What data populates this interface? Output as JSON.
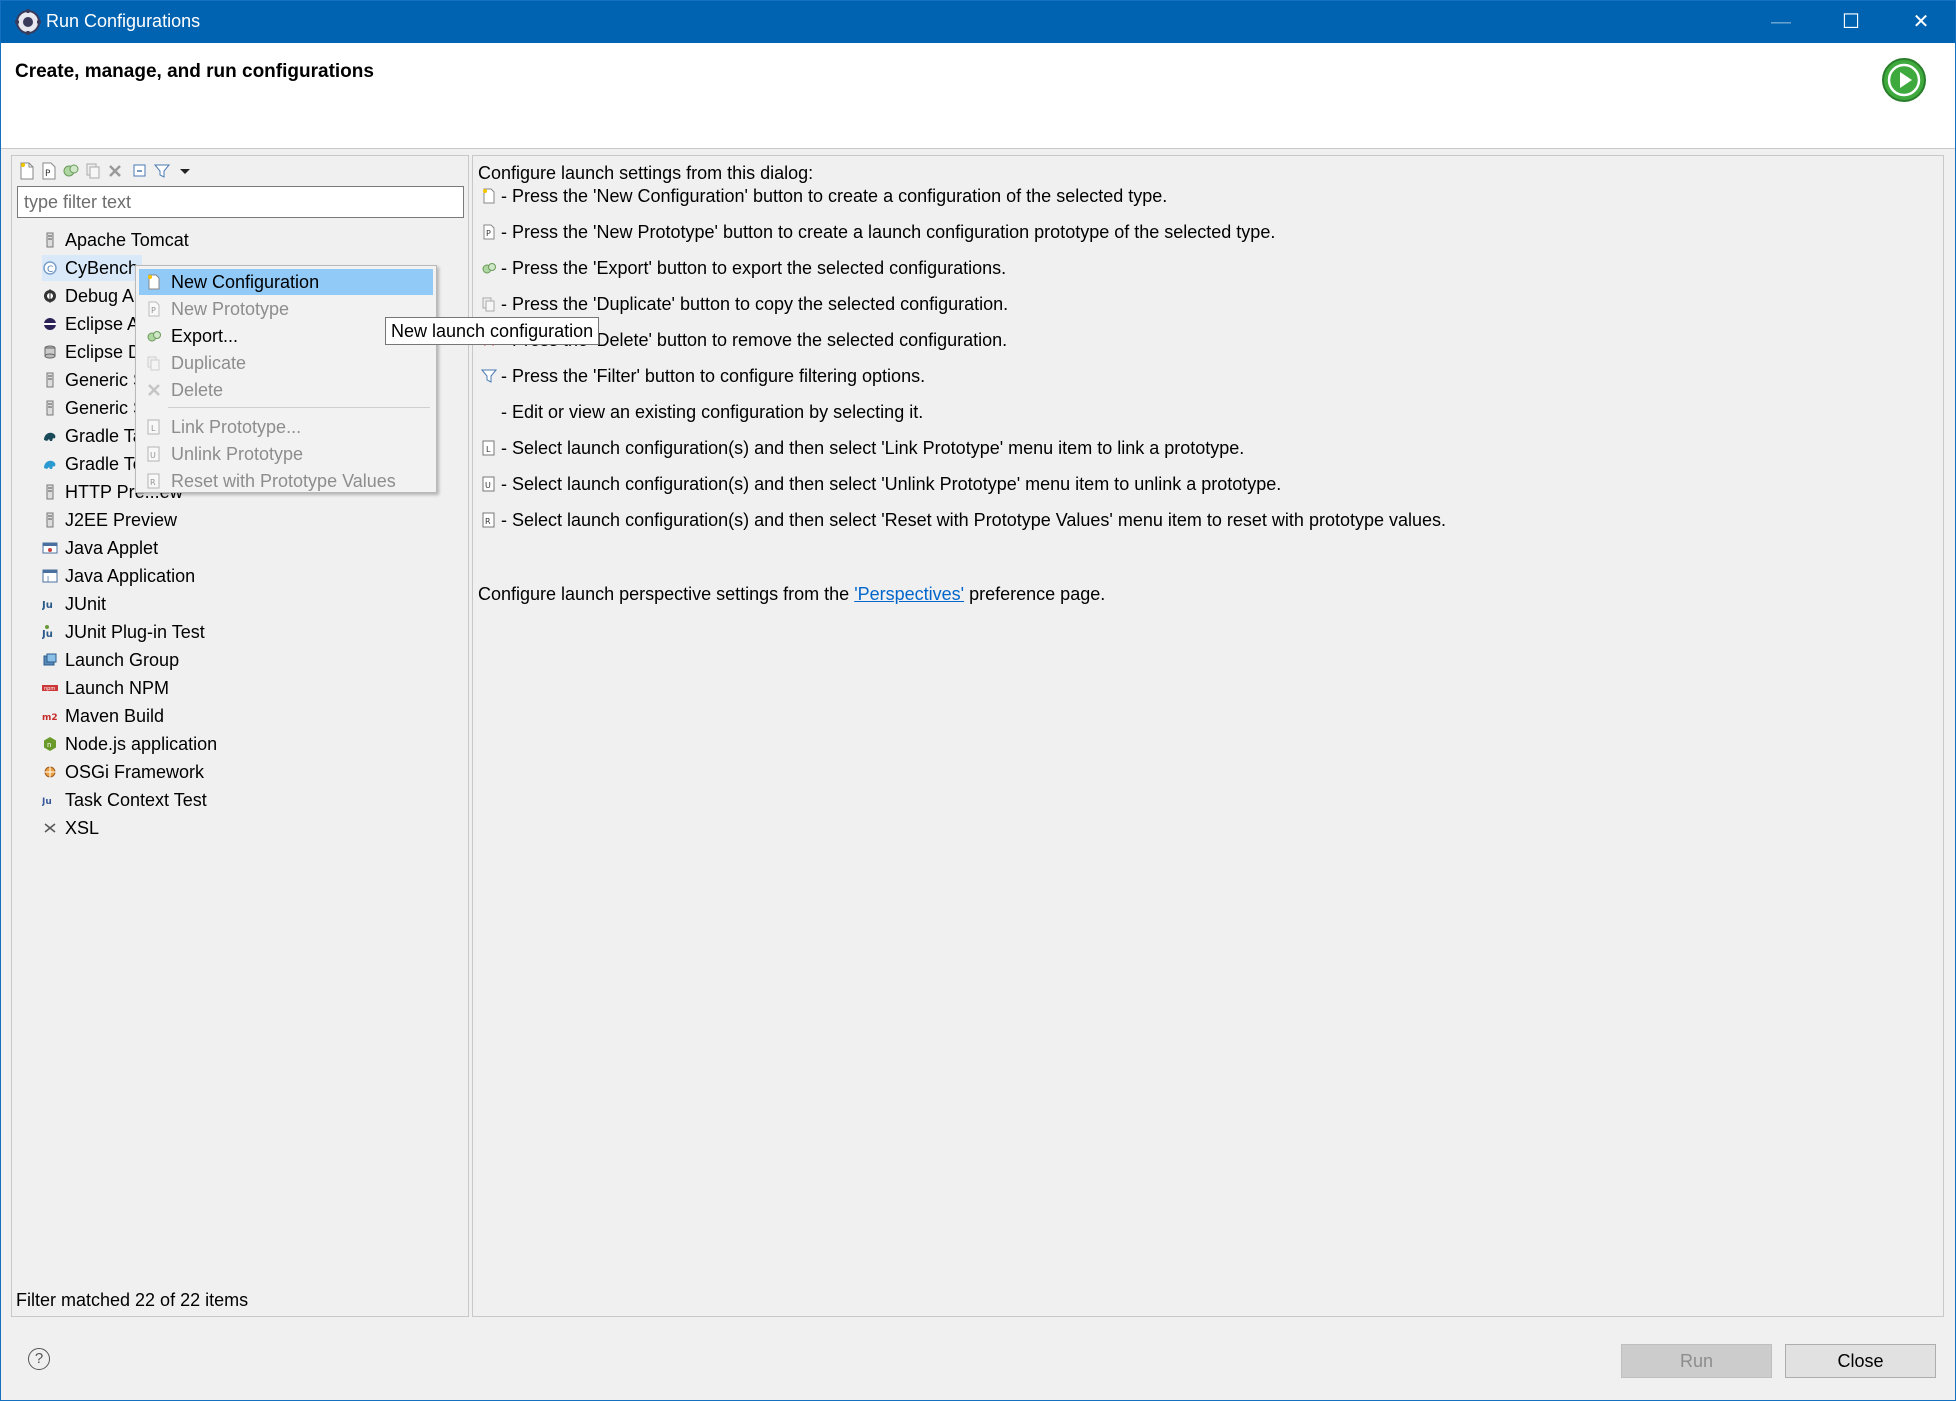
{
  "window": {
    "title": "Run Configurations",
    "minimize_glyph": "—",
    "maximize_glyph": "☐",
    "close_glyph": "✕"
  },
  "banner": {
    "heading": "Create, manage, and run configurations"
  },
  "left": {
    "filter_placeholder": "type filter text",
    "tree": [
      {
        "label": "Apache Tomcat",
        "icon": "server-icon"
      },
      {
        "label": "CyBench",
        "icon": "cybench-icon"
      },
      {
        "label": "Debug A",
        "icon": "debug-icon"
      },
      {
        "label": "Eclipse A",
        "icon": "eclipse-icon"
      },
      {
        "label": "Eclipse D",
        "icon": "database-icon"
      },
      {
        "label": "Generic S",
        "icon": "server-icon"
      },
      {
        "label": "Generic S",
        "icon": "server-icon"
      },
      {
        "label": "Gradle Ta",
        "icon": "gradle-icon"
      },
      {
        "label": "Gradle Te",
        "icon": "gradle-test-icon"
      },
      {
        "label": "HTTP Pre...ew",
        "icon": "server-icon"
      },
      {
        "label": "J2EE Preview",
        "icon": "server-icon"
      },
      {
        "label": "Java Applet",
        "icon": "applet-icon"
      },
      {
        "label": "Java Application",
        "icon": "java-app-icon"
      },
      {
        "label": "JUnit",
        "icon": "junit-icon"
      },
      {
        "label": "JUnit Plug-in Test",
        "icon": "junit-plugin-icon"
      },
      {
        "label": "Launch Group",
        "icon": "launch-group-icon"
      },
      {
        "label": "Launch NPM",
        "icon": "npm-icon"
      },
      {
        "label": "Maven Build",
        "icon": "maven-icon"
      },
      {
        "label": "Node.js application",
        "icon": "nodejs-icon"
      },
      {
        "label": "OSGi Framework",
        "icon": "osgi-icon"
      },
      {
        "label": "Task Context Test",
        "icon": "task-test-icon"
      },
      {
        "label": "XSL",
        "icon": "xsl-icon"
      }
    ],
    "status": "Filter matched 22 of 22 items"
  },
  "context_menu": {
    "items": [
      {
        "label": "New Configuration",
        "enabled": true,
        "highlighted": true,
        "icon": "new-config-icon"
      },
      {
        "label": "New Prototype",
        "enabled": false,
        "icon": "new-prototype-icon"
      },
      {
        "label": "Export...",
        "enabled": true,
        "icon": "export-icon"
      },
      {
        "label": "Duplicate",
        "enabled": false,
        "icon": "duplicate-icon"
      },
      {
        "label": "Delete",
        "enabled": false,
        "icon": "delete-icon"
      },
      {
        "label": "Link Prototype...",
        "enabled": false,
        "icon": "link-prototype-icon"
      },
      {
        "label": "Unlink Prototype",
        "enabled": false,
        "icon": "unlink-prototype-icon"
      },
      {
        "label": "Reset with Prototype Values",
        "enabled": false,
        "icon": "reset-prototype-icon"
      }
    ]
  },
  "tooltip": "New launch configuration",
  "right": {
    "intro": "Configure launch settings from this dialog:",
    "lines": [
      "- Press the 'New Configuration' button to create a configuration of the selected type.",
      "- Press the 'New Prototype' button to create a launch configuration prototype of the selected type.",
      "- Press the 'Export' button to export the selected configurations.",
      "- Press the 'Duplicate' button to copy the selected configuration.",
      "- Press the 'Delete' button to remove the selected configuration.",
      "- Press the 'Filter' button to configure filtering options.",
      "- Edit or view an existing configuration by selecting it.",
      "- Select launch configuration(s) and then select 'Link Prototype' menu item to link a prototype.",
      "- Select launch configuration(s) and then select 'Unlink Prototype' menu item to unlink a prototype.",
      "- Select launch configuration(s) and then select 'Reset with Prototype Values' menu item to reset with prototype values."
    ],
    "perspective_prefix": "Configure launch perspective settings from the ",
    "perspective_link": "'Perspectives'",
    "perspective_suffix": " preference page."
  },
  "footer": {
    "help": "?",
    "run_label": "Run",
    "close_label": "Close"
  },
  "colors": {
    "titlebar": "#0063b1",
    "menu_highlight": "#91c9f7",
    "selection": "#d9e9f9",
    "link": "#0066cc"
  }
}
